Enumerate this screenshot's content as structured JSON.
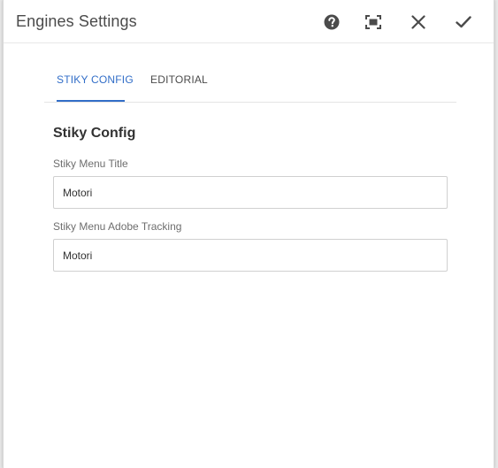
{
  "dialog": {
    "title": "Engines Settings",
    "actions": [
      {
        "name": "help",
        "icon": "help-icon"
      },
      {
        "name": "fullscreen",
        "icon": "fullscreen-icon"
      },
      {
        "name": "close",
        "icon": "close-icon"
      },
      {
        "name": "done",
        "icon": "checkmark-icon"
      }
    ]
  },
  "tabs": [
    {
      "label": "STIKY CONFIG",
      "active": true
    },
    {
      "label": "EDITORIAL",
      "active": false
    }
  ],
  "section": {
    "title": "Stiky Config"
  },
  "fields": [
    {
      "label": "Stiky Menu Title",
      "value": "Motori"
    },
    {
      "label": "Stiky Menu Adobe Tracking",
      "value": "Motori"
    }
  ],
  "colors": {
    "accent": "#326ec8",
    "icon": "#4b4b4b"
  }
}
